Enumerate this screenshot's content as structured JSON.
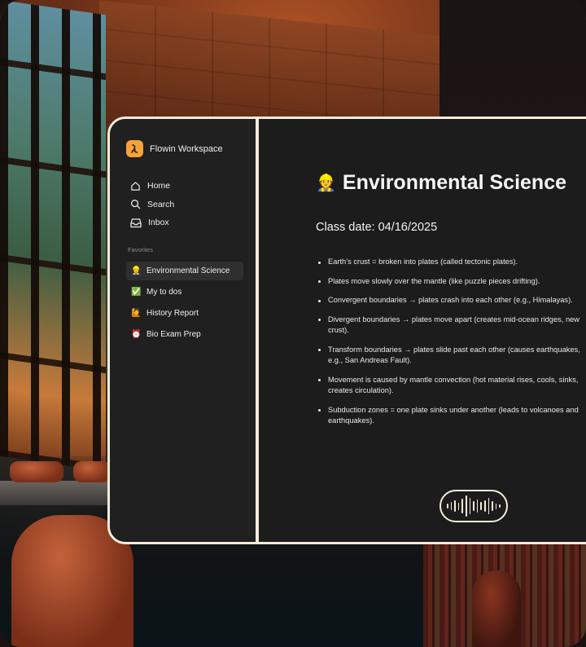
{
  "workspace": {
    "name": "Flowin Workspace",
    "logo_icon": "flowin-logo-icon",
    "brand_color": "#f7a23b"
  },
  "nav": [
    {
      "label": "Home",
      "icon": "home-icon"
    },
    {
      "label": "Search",
      "icon": "search-icon"
    },
    {
      "label": "Inbox",
      "icon": "inbox-icon"
    }
  ],
  "favorites": {
    "label": "Favorites",
    "items": [
      {
        "emoji": "👷",
        "label": "Environmental Science",
        "active": true
      },
      {
        "emoji": "✅",
        "label": "My to dos"
      },
      {
        "emoji": "🙋",
        "label": "History Report"
      },
      {
        "emoji": "⏰",
        "label": "Bio Exam Prep"
      }
    ]
  },
  "page": {
    "emoji": "👷",
    "title": "Environmental Science",
    "class_date": "Class date: 04/16/2025",
    "notes": [
      "Earth’s crust = broken into plates (called tectonic plates).",
      "Plates move slowly over the mantle (like puzzle pieces drifting).",
      "Convergent boundaries → plates crash into each other (e.g., Himalayas).",
      "Divergent boundaries → plates move apart (creates mid-ocean ridges, new\ncrust).",
      "Transform boundaries → plates slide past each other (causes earthquakes,\ne.g., San Andreas Fault).",
      "Movement is caused by mantle convection (hot material rises, cools, sinks,\ncreates circulation).",
      "Subduction zones = one plate sinks under another (leads to volcanoes and\nearthquakes)."
    ]
  },
  "voice_button": {
    "icon": "voice-waveform-icon"
  },
  "colors": {
    "frame": "#f3ecd8",
    "sidebar_bg": "#202020",
    "main_bg": "#1c1c1c"
  }
}
